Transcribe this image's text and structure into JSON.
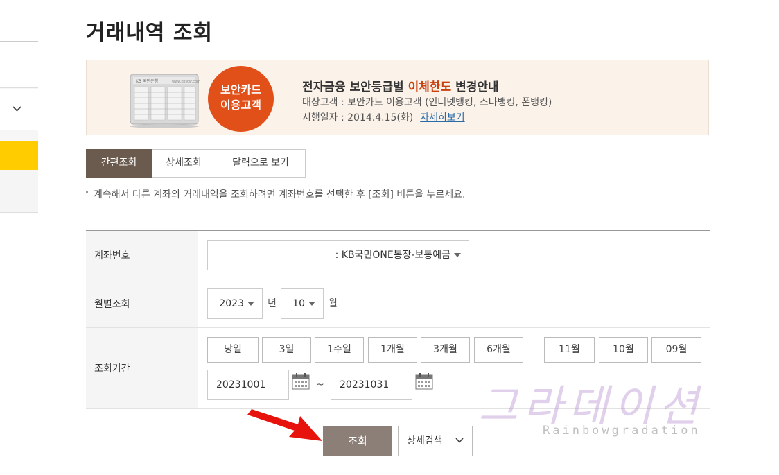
{
  "page_title": "거래내역 조회",
  "banner": {
    "circle_line1": "보안카드",
    "circle_line2": "이용고객",
    "title_pre": "전자금융 보안등급별 ",
    "title_highlight": "이체한도",
    "title_post": " 변경안내",
    "target": "대상고객 : 보안카드 이용고객 (인터넷뱅킹, 스타뱅킹, 폰뱅킹)",
    "date": "시행일자 : 2014.4.15(화)",
    "link": "자세히보기"
  },
  "tabs": [
    {
      "label": "간편조회",
      "active": true
    },
    {
      "label": "상세조회",
      "active": false
    },
    {
      "label": "달력으로 보기",
      "active": false
    }
  ],
  "note": "계속해서 다른 계좌의 거래내역을 조회하려면 계좌번호를 선택한 후 [조회] 버튼을 누르세요.",
  "form": {
    "account": {
      "label": "계좌번호",
      "value": ": KB국민ONE통장-보통예금"
    },
    "month": {
      "label": "월별조회",
      "year": "2023",
      "year_unit": "년",
      "month": "10",
      "month_unit": "월"
    },
    "period": {
      "label": "조회기간",
      "buttons": [
        "당일",
        "3일",
        "1주일",
        "1개월",
        "3개월",
        "6개월"
      ],
      "month_buttons": [
        "11월",
        "10월",
        "09월"
      ],
      "from": "20231001",
      "separator": "~",
      "to": "20231031"
    }
  },
  "actions": {
    "search": "조회",
    "detail": "상세검색"
  },
  "watermark": {
    "title": "그라데이션",
    "sub": "Rainbowgradation"
  },
  "colors": {
    "accent": "#6b5b4e",
    "highlight": "#c8400e",
    "circle": "#e2501a",
    "search_button": "#8b7f78",
    "sidebar_active": "#ffcc00"
  }
}
